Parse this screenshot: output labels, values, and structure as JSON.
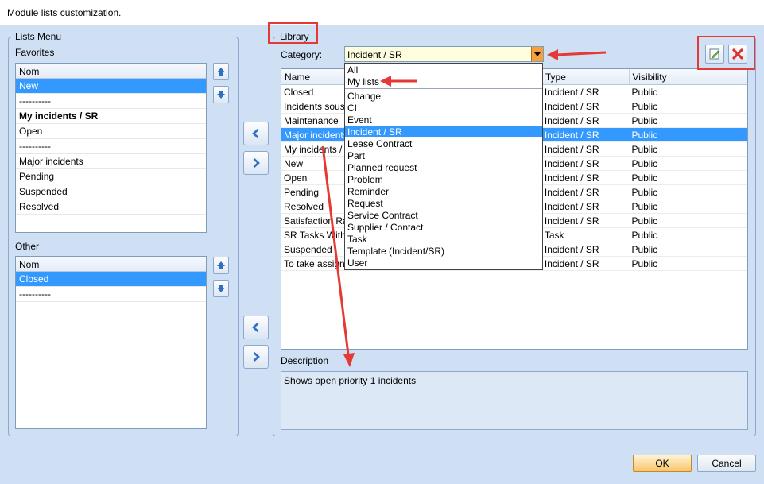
{
  "window": {
    "title": "Module lists customization."
  },
  "lists_menu": {
    "legend": "Lists Menu",
    "favorites_label": "Favorites",
    "favorites_header": "Nom",
    "favorites": [
      "New",
      "----------",
      "My incidents / SR",
      "Open",
      "----------",
      "Major incidents",
      "Pending",
      "Suspended",
      "Resolved"
    ],
    "other_label": "Other",
    "other_header": "Nom",
    "other": [
      "Closed",
      "----------"
    ]
  },
  "library": {
    "legend": "Library",
    "category_label": "Category:",
    "category_value": "Incident / SR",
    "columns": [
      "Name",
      "Type",
      "Visibility"
    ],
    "rows": [
      [
        "Closed",
        "Incident / SR",
        "Public"
      ],
      [
        "Incidents sous-",
        "Incident / SR",
        "Public"
      ],
      [
        "Maintenance",
        "Incident / SR",
        "Public"
      ],
      [
        "Major incidents",
        "Incident / SR",
        "Public"
      ],
      [
        "My incidents / S",
        "Incident / SR",
        "Public"
      ],
      [
        "New",
        "Incident / SR",
        "Public"
      ],
      [
        "Open",
        "Incident / SR",
        "Public"
      ],
      [
        "Pending",
        "Incident / SR",
        "Public"
      ],
      [
        "Resolved",
        "Incident / SR",
        "Public"
      ],
      [
        "Satisfaction Ra",
        "Incident / SR",
        "Public"
      ],
      [
        "SR Tasks Witho",
        "Task",
        "Public"
      ],
      [
        "Suspended",
        "Incident / SR",
        "Public"
      ],
      [
        "To take assign",
        "Incident / SR",
        "Public"
      ]
    ],
    "description_label": "Description",
    "description_text": "Shows open priority 1 incidents"
  },
  "dropdown": {
    "top_items": [
      "All",
      "My lists"
    ],
    "items": [
      "Change",
      "CI",
      "Event",
      "Incident / SR",
      "Lease Contract",
      "Part",
      "Planned request",
      "Problem",
      "Reminder",
      "Request",
      "Service Contract",
      "Supplier / Contact",
      "Task",
      "Template (Incident/SR)",
      "User"
    ]
  },
  "buttons": {
    "ok": "OK",
    "cancel": "Cancel"
  },
  "colors": {
    "selection": "#3399ff",
    "annotation": "#e53935",
    "ok_button": "#f8c46a"
  }
}
